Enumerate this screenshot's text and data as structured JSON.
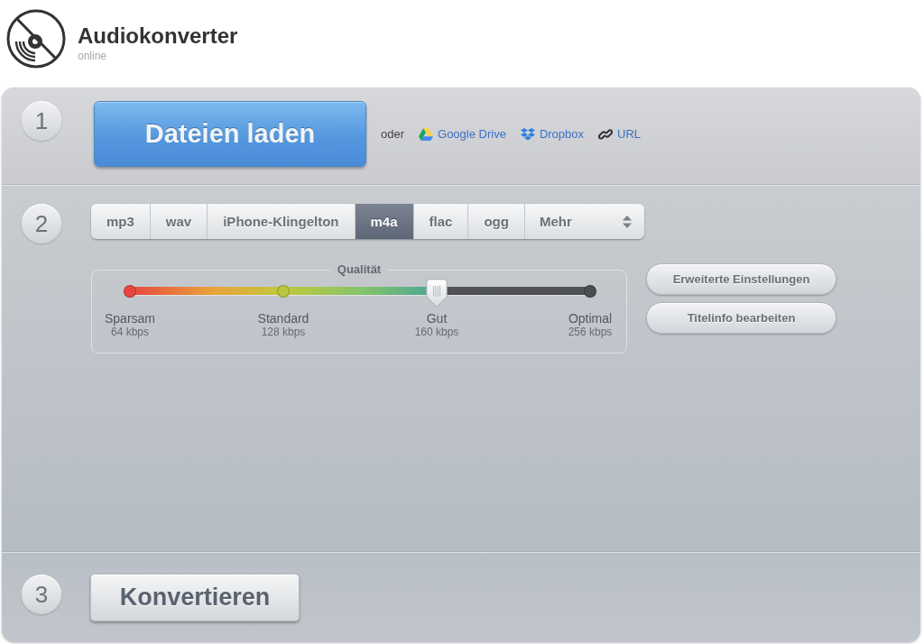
{
  "header": {
    "title": "Audiokonverter",
    "subtitle": "online"
  },
  "steps": [
    {
      "kind": "upload",
      "number": "1",
      "button": "Dateien laden",
      "separator": "oder",
      "sources": [
        {
          "kind": "google-drive",
          "label": "Google Drive"
        },
        {
          "kind": "dropbox",
          "label": "Dropbox"
        },
        {
          "kind": "url",
          "label": "URL"
        }
      ]
    },
    {
      "kind": "format",
      "number": "2",
      "formats": [
        {
          "kind": "tab",
          "label": "mp3",
          "selected": false
        },
        {
          "kind": "tab",
          "label": "wav",
          "selected": false
        },
        {
          "kind": "tab",
          "label": "iPhone-Klingelton",
          "selected": false
        },
        {
          "kind": "tab",
          "label": "m4a",
          "selected": true
        },
        {
          "kind": "tab",
          "label": "flac",
          "selected": false
        },
        {
          "kind": "tab",
          "label": "ogg",
          "selected": false
        },
        {
          "kind": "dropdown",
          "label": "Mehr",
          "selected": false
        }
      ],
      "quality": {
        "title": "Qualität",
        "level": 0.667,
        "stops": [
          {
            "name": "Sparsam",
            "bitrate": "64 kbps"
          },
          {
            "name": "Standard",
            "bitrate": "128 kbps"
          },
          {
            "name": "Gut",
            "bitrate": "160 kbps"
          },
          {
            "name": "Optimal",
            "bitrate": "256 kbps"
          }
        ]
      },
      "buttons": [
        "Erweiterte Einstellungen",
        "Titelinfo bearbeiten"
      ]
    },
    {
      "kind": "convert",
      "number": "3",
      "button": "Konvertieren"
    }
  ]
}
